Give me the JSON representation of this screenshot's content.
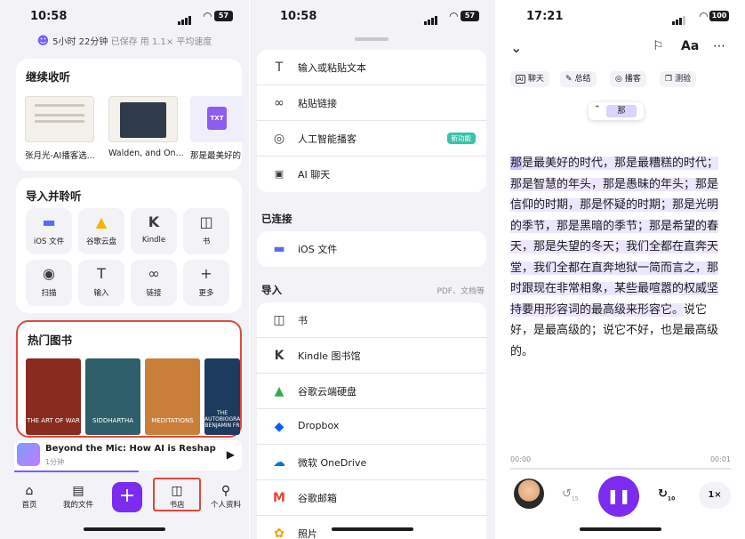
{
  "screen1": {
    "time": "10:58",
    "battery": "57",
    "saved": {
      "duration": "5小时 22分钟",
      "text": " 已保存 ",
      "speed": "用 1.1× 平均速度"
    },
    "continue": {
      "title": "继续收听",
      "items": [
        {
          "caption": "张月光-AI播客选..."
        },
        {
          "caption": "Walden, and On..."
        },
        {
          "caption": "那是最美好的"
        }
      ],
      "txt_badge": "TXT"
    },
    "import": {
      "title": "导入并聆听",
      "tiles": [
        {
          "label": "iOS 文件",
          "icon": "folder-icon",
          "glyph": "▬"
        },
        {
          "label": "谷歌云盘",
          "icon": "google-drive-icon",
          "glyph": "▲"
        },
        {
          "label": "Kindle",
          "icon": "kindle-icon",
          "glyph": "K"
        },
        {
          "label": "书",
          "icon": "book-icon",
          "glyph": "◫"
        },
        {
          "label": "扫描",
          "icon": "camera-icon",
          "glyph": "◉"
        },
        {
          "label": "输入",
          "icon": "text-icon",
          "glyph": "T"
        },
        {
          "label": "链接",
          "icon": "link-icon",
          "glyph": "∞"
        },
        {
          "label": "更多",
          "icon": "plus-icon",
          "glyph": "+"
        }
      ]
    },
    "hot_books": {
      "title": "热门图书",
      "books": [
        {
          "title": "THE ART OF WAR",
          "color": "#8a2b1f"
        },
        {
          "title": "SIDDHARTHA",
          "color": "#2f5f6a"
        },
        {
          "title": "MEDITATIONS",
          "color": "#c97f3a"
        },
        {
          "title": "THE AUTOBIOGRAPHY BENJAMIN FR",
          "color": "#1d3b5c"
        }
      ]
    },
    "mini_player": {
      "title": "Beyond the Mic: How AI is Reshaping Yo",
      "sub": "1分钟"
    },
    "tabs": [
      {
        "label": "首页",
        "icon": "home-icon",
        "glyph": "⌂"
      },
      {
        "label": "我的文件",
        "icon": "file-icon",
        "glyph": "▤"
      },
      {
        "label": "书店",
        "icon": "bookstore-icon",
        "glyph": "◫"
      },
      {
        "label": "个人资料",
        "icon": "person-icon",
        "glyph": "⚲"
      }
    ],
    "fab": "+"
  },
  "screen2": {
    "time": "10:58",
    "battery": "57",
    "top_rows": [
      {
        "label": "输入或粘贴文本",
        "glyph": "T",
        "icon": "text-icon"
      },
      {
        "label": "粘贴链接",
        "glyph": "∞",
        "icon": "link-icon"
      },
      {
        "label": "人工智能播客",
        "glyph": "◎",
        "icon": "podcast-icon",
        "badge": "新功能"
      },
      {
        "label": "AI 聊天",
        "glyph": "▣",
        "icon": "ai-chat-icon"
      }
    ],
    "connected": {
      "title": "已连接",
      "rows": [
        {
          "label": "iOS 文件",
          "glyph": "▬",
          "icon": "folder-icon"
        }
      ]
    },
    "import": {
      "title": "导入",
      "note": "PDF、文档等",
      "rows": [
        {
          "label": "书",
          "glyph": "◫",
          "icon": "book-icon"
        },
        {
          "label": "Kindle 图书馆",
          "glyph": "K",
          "icon": "kindle-icon"
        },
        {
          "label": "谷歌云端硬盘",
          "glyph": "▲",
          "icon": "google-drive-icon"
        },
        {
          "label": "Dropbox",
          "glyph": "◆",
          "icon": "dropbox-icon"
        },
        {
          "label": "微软 OneDrive",
          "glyph": "☁",
          "icon": "onedrive-icon"
        },
        {
          "label": "谷歌邮箱",
          "glyph": "M",
          "icon": "gmail-icon"
        },
        {
          "label": "照片",
          "glyph": "✿",
          "icon": "photos-icon"
        }
      ]
    }
  },
  "screen3": {
    "time": "17:21",
    "battery": "100",
    "font_btn": "Aa",
    "chips": [
      {
        "label": "聊天",
        "icon": "ai-icon",
        "glyph": "AI"
      },
      {
        "label": "总结",
        "icon": "summary-icon",
        "glyph": "✎"
      },
      {
        "label": "播客",
        "icon": "podcast-icon",
        "glyph": "◎"
      },
      {
        "label": "测验",
        "icon": "quiz-icon",
        "glyph": "❐"
      }
    ],
    "popup_word": "那",
    "text": {
      "highlight_word": "那",
      "highlight_rest": "是最美好的时代，那是最糟糕的时代；那是智慧的年头，那是愚昧的年头；那是信仰的时期，那是怀疑的时期；那是光明的季节，那是黑暗的季节；那是希望的春天，那是失望的冬天；我们全都在直奔天堂，我们全都在直奔地狱一简而言之，那时跟现在非常相象，某些最喧嚣的权威坚持要用形容词的最高级来形容它。",
      "plain": "说它好，是最高级的；说它不好，也是最高级的。"
    },
    "time_start": "00:00",
    "time_end": "00:01",
    "speed": "1×",
    "skip_back": "15",
    "skip_fwd": "10"
  }
}
